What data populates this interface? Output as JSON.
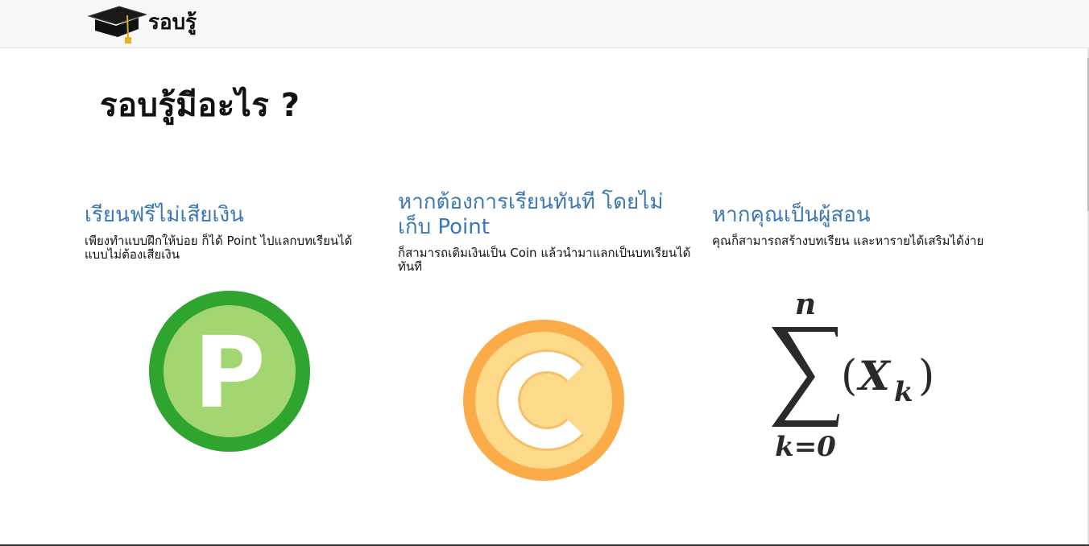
{
  "navbar": {
    "brand_name": "รอบรู้",
    "logo_icon": "graduation-cap-icon"
  },
  "page": {
    "title": "รอบรู้มีอะไร ?"
  },
  "features": [
    {
      "heading": "เรียนฟรีไม่เสียเงิน",
      "description": "เพียงทำแบบฝึกให้บ่อย ก็ได้ Point ไปแลกบทเรียนได้แบบไม่ต้องเสียเงิน",
      "icon": "point-coin-icon",
      "icon_letter": "P",
      "colors": {
        "outer": "#2fa52f",
        "inner": "#a3d670",
        "letter": "#ffffff"
      }
    },
    {
      "heading": "หากต้องการเรียนทันที โดยไม่เก็บ Point",
      "description": "ก็สามารถเติมเงินเป็น Coin แล้วนำมาแลกเป็นบทเรียนได้ทันที",
      "icon": "coin-icon",
      "icon_letter": "C",
      "colors": {
        "outer": "#fbab47",
        "inner": "#fdd98a",
        "letter": "#ffffff"
      }
    },
    {
      "heading": "หากคุณเป็นผู้สอน",
      "description": "คุณก็สามารถสร้างบทเรียน และหารายได้เสริมได้ง่าย",
      "icon": "summation-icon",
      "formula": {
        "upper": "n",
        "lower": "k=0",
        "term_open": "(",
        "term_var": "X",
        "term_sub": "k",
        "term_close": ")"
      }
    }
  ],
  "theme": {
    "heading_color": "#3a78b5",
    "navbar_bg": "#f7f7f7"
  }
}
